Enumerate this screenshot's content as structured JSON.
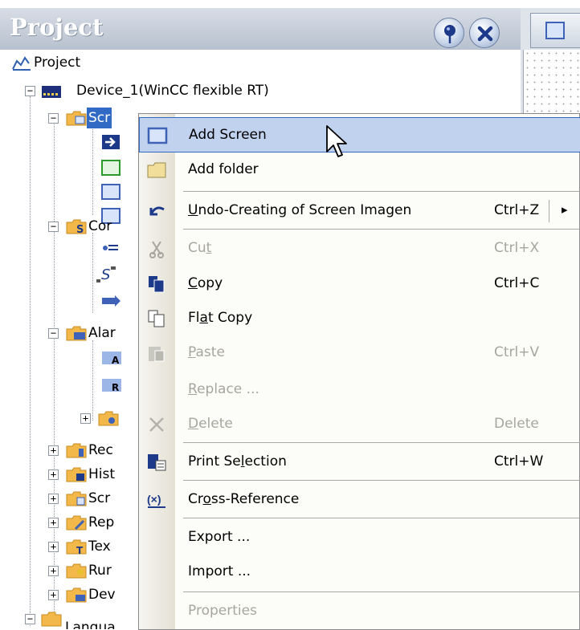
{
  "panel": {
    "title": "Project",
    "pin_icon": "pin-icon",
    "close_icon": "close-icon"
  },
  "tree": {
    "root": "Project",
    "device": "Device_1(WinCC flexible RT)",
    "screens": "Scr",
    "communication": "Cor",
    "alarms": "Alar",
    "recipes": "Rec",
    "historical": "Hist",
    "scripts": "Scr",
    "reports": "Rep",
    "texts": "Tex",
    "runtime": "Rur",
    "device_settings": "Dev",
    "language": "Langua"
  },
  "menu": {
    "items": [
      {
        "label": "Add Screen",
        "shortcut": "",
        "icon": "screen-icon"
      },
      {
        "label": "Add folder",
        "shortcut": "",
        "icon": "folder-icon"
      },
      {
        "label": "Undo-Creating of Screen Imagen",
        "shortcut": "Ctrl+Z",
        "icon": "undo-icon",
        "submenu": "▸"
      },
      {
        "label": "Cut",
        "shortcut": "Ctrl+X",
        "icon": "cut-icon"
      },
      {
        "label": "Copy",
        "shortcut": "Ctrl+C",
        "icon": "copy-icon"
      },
      {
        "label": "Flat Copy",
        "shortcut": "",
        "icon": "flat-copy-icon"
      },
      {
        "label": "Paste",
        "shortcut": "Ctrl+V",
        "icon": "paste-icon"
      },
      {
        "label": "Replace ...",
        "shortcut": "",
        "icon": ""
      },
      {
        "label": "Delete",
        "shortcut": "Delete",
        "icon": "delete-icon"
      },
      {
        "label": "Print Selection",
        "shortcut": "Ctrl+W",
        "icon": "print-icon"
      },
      {
        "label": "Cross-Reference",
        "shortcut": "",
        "icon": "cross-reference-icon"
      },
      {
        "label": "Export ...",
        "shortcut": "",
        "icon": ""
      },
      {
        "label": "Import ...",
        "shortcut": "",
        "icon": ""
      },
      {
        "label": "Properties",
        "shortcut": "",
        "icon": ""
      }
    ]
  },
  "colors": {
    "selection": "#316ac5",
    "menu_highlight": "#c1d2ee",
    "disabled_text": "#a7a69e",
    "title_bar": "#b8c1cf"
  }
}
